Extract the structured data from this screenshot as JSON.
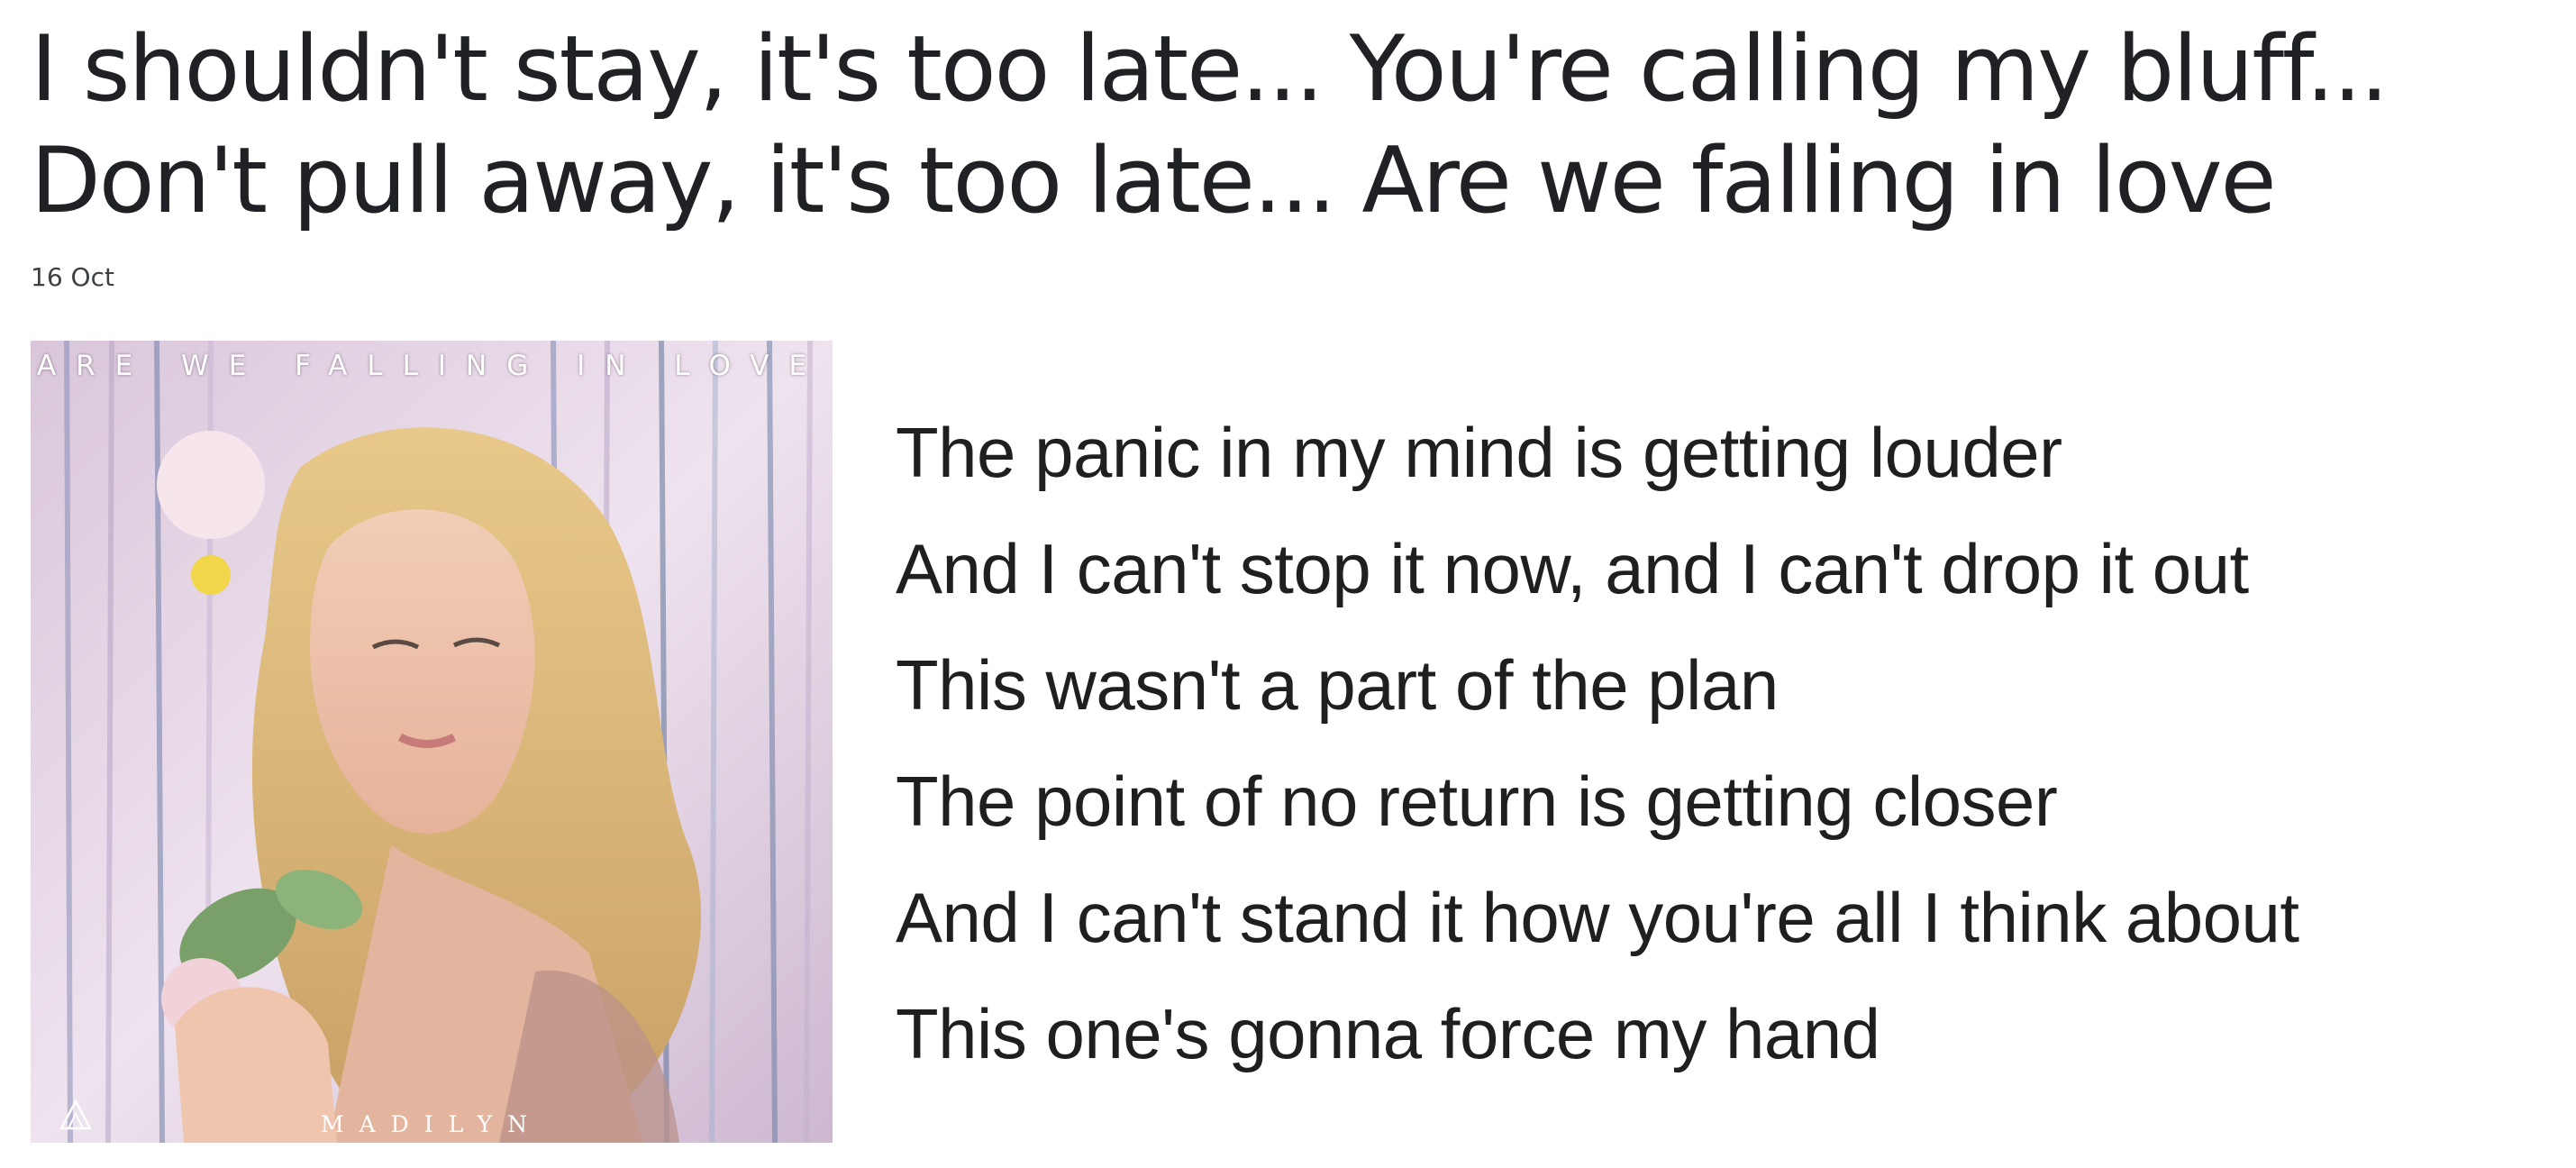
{
  "post": {
    "title_line1": "I shouldn't stay, it's too late... You're calling my bluff...",
    "title_line2": "Don't pull away, it's too late... Are we falling in love",
    "date": "16 Oct"
  },
  "cover": {
    "title": "ARE WE FALLING IN LOVE",
    "artist": "MADILYN"
  },
  "lyrics": [
    "The panic in my mind is getting louder",
    "And I can't stop it now, and I can't drop it out",
    "This wasn't a part of the plan",
    "The point of no return is getting closer",
    "And I can't stand it how you're all I think about",
    "This one's gonna force my hand"
  ],
  "colors": {
    "text": "#202124",
    "lyrics_text": "#1f1f1f",
    "date_text": "#3c4043",
    "background": "#ffffff"
  }
}
